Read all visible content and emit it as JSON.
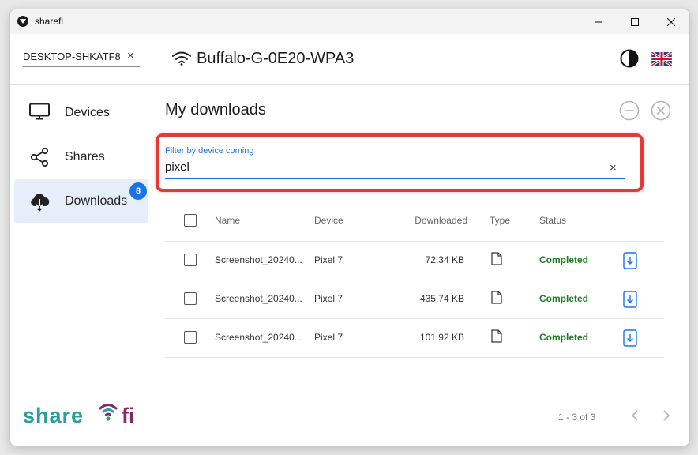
{
  "window": {
    "title": "sharefi"
  },
  "header": {
    "device_name": "DESKTOP-SHKATF8",
    "device_clear": "×",
    "network_name": "Buffalo-G-0E20-WPA3"
  },
  "sidebar": {
    "items": [
      {
        "label": "Devices",
        "icon": "monitor-icon"
      },
      {
        "label": "Shares",
        "icon": "share-icon"
      },
      {
        "label": "Downloads",
        "icon": "cloud-download-icon",
        "badge": "8",
        "active": true
      }
    ]
  },
  "main": {
    "title": "My downloads",
    "filter": {
      "label": "Filter by device coming",
      "value": "pixel",
      "clear": "×"
    },
    "table": {
      "columns": [
        "Name",
        "Device",
        "Downloaded",
        "Type",
        "Status"
      ],
      "rows": [
        {
          "name": "Screenshot_20240...",
          "device": "Pixel 7",
          "downloaded": "72.34 KB",
          "type": "file-icon",
          "status": "Completed"
        },
        {
          "name": "Screenshot_20240...",
          "device": "Pixel 7",
          "downloaded": "435.74 KB",
          "type": "file-icon",
          "status": "Completed"
        },
        {
          "name": "Screenshot_20240...",
          "device": "Pixel 7",
          "downloaded": "101.92 KB",
          "type": "file-icon",
          "status": "Completed"
        }
      ]
    },
    "pagination": {
      "text": "1 - 3 of 3"
    }
  },
  "brand": {
    "logo_text": "sharefi"
  },
  "colors": {
    "accent": "#1a73e8",
    "status_completed": "#1e7d1e",
    "highlight": "#e53935",
    "brand_teal": "#2a9d9d",
    "brand_purple": "#7b2d6b"
  }
}
